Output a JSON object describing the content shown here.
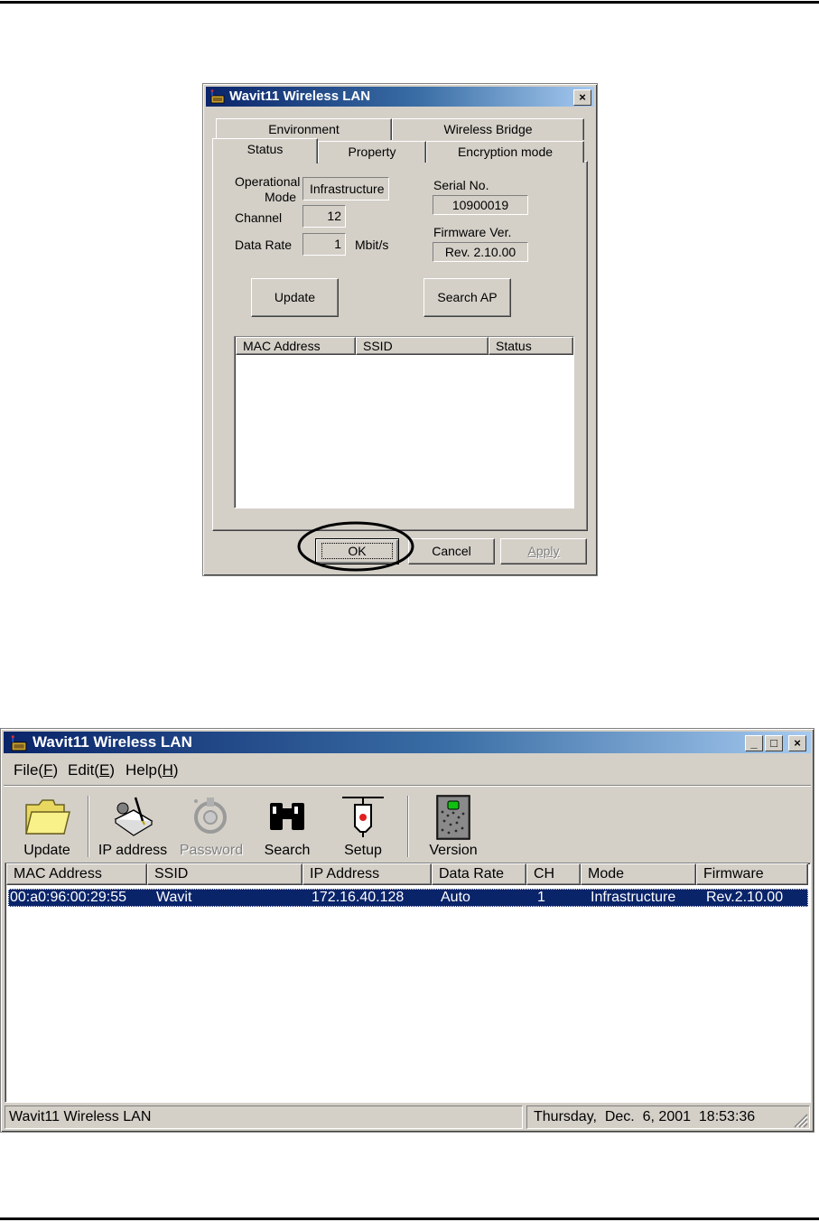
{
  "dialog": {
    "title": "Wavit11 Wireless LAN",
    "close_label": "×",
    "tabs_back": [
      "Environment",
      "Wireless Bridge"
    ],
    "tabs_front": [
      "Status",
      "Property",
      "Encryption mode"
    ],
    "active_tab": "Status",
    "operational_mode_label_1": "Operational",
    "operational_mode_label_2": "Mode",
    "operational_mode_value": "Infrastructure",
    "channel_label": "Channel",
    "channel_value": "12",
    "data_rate_label": "Data Rate",
    "data_rate_value": "1",
    "data_rate_unit": "Mbit/s",
    "serial_label": "Serial No.",
    "serial_value": "10900019",
    "firmware_label": "Firmware Ver.",
    "firmware_value": "Rev. 2.10.00",
    "update_button": "Update",
    "search_ap_button": "Search AP",
    "ap_columns": [
      "MAC Address",
      "SSID",
      "Status"
    ],
    "ok_button": "OK",
    "cancel_button": "Cancel",
    "apply_button": "Apply"
  },
  "main": {
    "title": "Wavit11 Wireless LAN",
    "caption_buttons": {
      "minimize": "_",
      "maximize": "□",
      "close": "×"
    },
    "menu": [
      {
        "label": "File(",
        "key": "F",
        "end": ")"
      },
      {
        "label": "Edit(",
        "key": "E",
        "end": ")"
      },
      {
        "label": "Help(",
        "key": "H",
        "end": ")"
      }
    ],
    "toolbar": [
      {
        "label": "Update",
        "icon": "folder-icon",
        "enabled": true
      },
      {
        "label": "IP address",
        "icon": "ip-address-icon",
        "enabled": true
      },
      {
        "label": "Password",
        "icon": "password-icon",
        "enabled": false
      },
      {
        "label": "Search",
        "icon": "binoculars-icon",
        "enabled": true
      },
      {
        "label": "Setup",
        "icon": "setup-icon",
        "enabled": true
      },
      {
        "label": "Version",
        "icon": "version-icon",
        "enabled": true
      }
    ],
    "columns": [
      "MAC Address",
      "SSID",
      "IP Address",
      "Data Rate",
      "CH",
      "Mode",
      "Firmware"
    ],
    "rows": [
      {
        "mac": "00:a0:96:00:29:55",
        "ssid": "Wavit",
        "ip": "172.16.40.128",
        "rate": "Auto",
        "ch": "1",
        "mode": "Infrastructure",
        "firmware": "Rev.2.10.00"
      }
    ],
    "status_left": "Wavit11 Wireless LAN",
    "status_right": "Thursday,  Dec.  6, 2001  18:53:36"
  },
  "colors": {
    "titlebar_start": "#0a246a",
    "titlebar_end": "#a6caf0",
    "face": "#d4d0c8",
    "selection": "#0a246a",
    "highlight_circle": "#000000"
  }
}
